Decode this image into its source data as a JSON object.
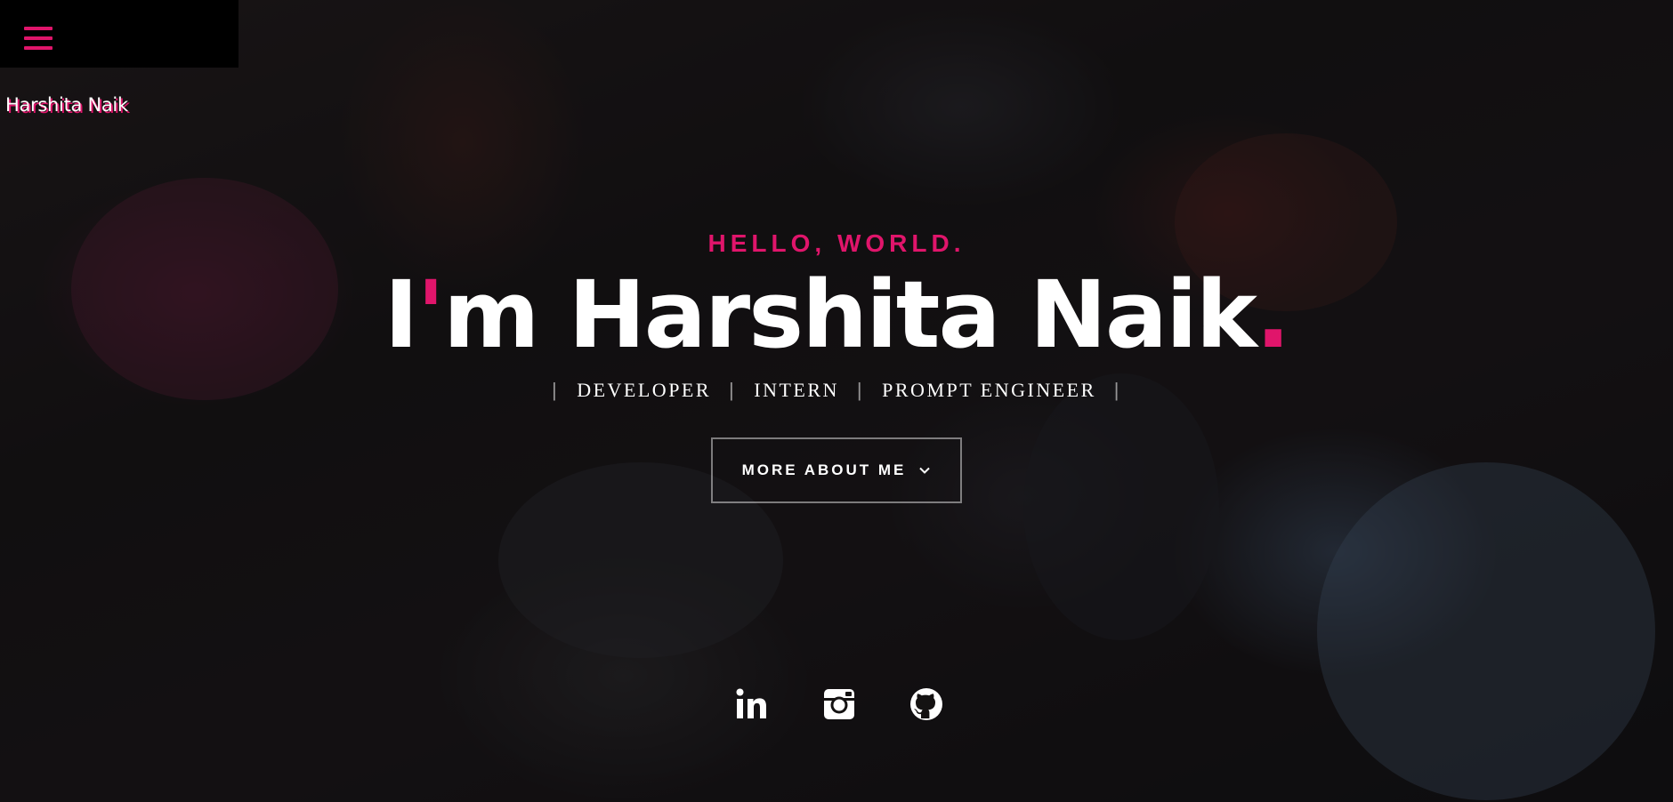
{
  "brand": {
    "name": "Harshita Naik"
  },
  "colors": {
    "accent": "#e0156b",
    "text": "#ffffff",
    "menu_bg": "#000000"
  },
  "icons": {
    "menu": "hamburger-menu-icon",
    "chevron": "chevron-down-icon",
    "linkedin": "linkedin-icon",
    "instagram": "instagram-icon",
    "github": "github-icon"
  },
  "hero": {
    "greeting": "HELLO, WORLD.",
    "headline_i": "I",
    "headline_apostrophe": "'",
    "headline_rest": "m Harshita Naik",
    "headline_dot": ".",
    "roles": [
      "DEVELOPER",
      "INTERN",
      "PROMPT ENGINEER"
    ],
    "separator": "|",
    "cta_label": "MORE ABOUT ME"
  }
}
